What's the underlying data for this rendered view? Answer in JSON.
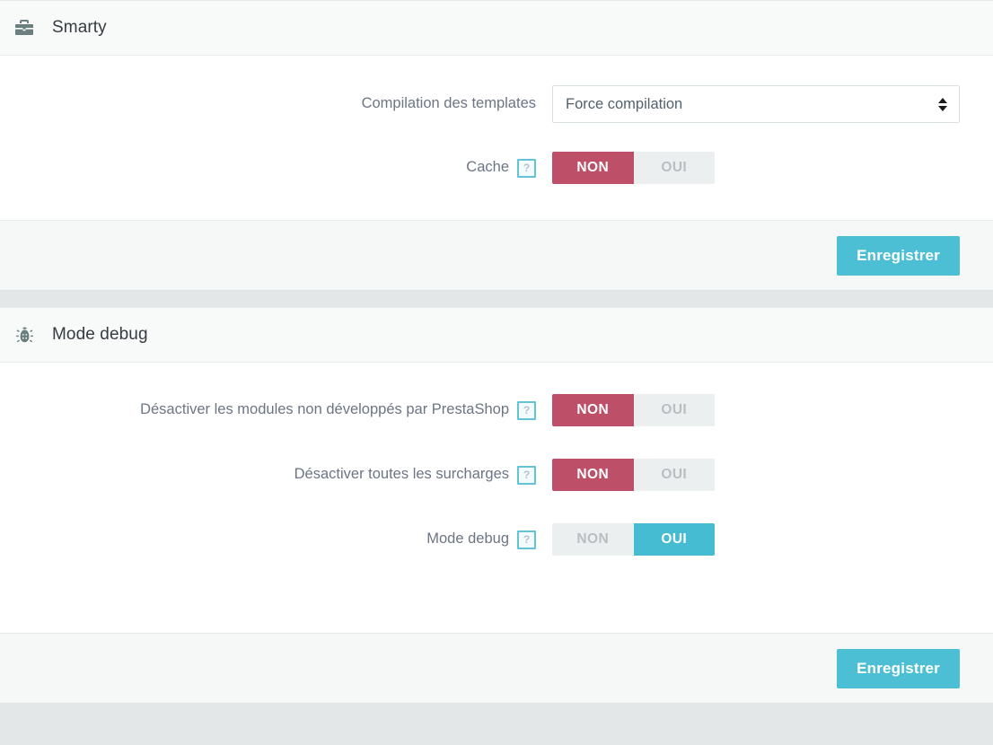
{
  "panels": [
    {
      "id": "smarty",
      "icon": "briefcase-icon",
      "title": "Smarty",
      "rows": [
        {
          "label": "Compilation des templates",
          "help": "",
          "type": "select",
          "value": "Force compilation"
        },
        {
          "label": "Cache",
          "help": "?",
          "type": "toggle",
          "no_label": "NON",
          "yes_label": "OUI",
          "state": "no"
        }
      ],
      "save_label": "Enregistrer"
    },
    {
      "id": "debug",
      "icon": "bug-icon",
      "title": "Mode debug",
      "rows": [
        {
          "label": "Désactiver les modules non développés par PrestaShop",
          "help": "?",
          "type": "toggle",
          "no_label": "NON",
          "yes_label": "OUI",
          "state": "no"
        },
        {
          "label": "Désactiver toutes les surcharges",
          "help": "?",
          "type": "toggle",
          "no_label": "NON",
          "yes_label": "OUI",
          "state": "no"
        },
        {
          "label": "Mode debug",
          "help": "?",
          "type": "toggle",
          "no_label": "NON",
          "yes_label": "OUI",
          "state": "yes"
        }
      ],
      "save_label": "Enregistrer"
    }
  ],
  "colors": {
    "accent_turquoise": "#4cbfd4",
    "toggle_on_no": "#bd4f68",
    "toggle_on_yes": "#45bcd2",
    "toggle_off_bg": "#eceff0",
    "panel_header_bg": "#f7faf9",
    "panel_footer_bg": "#f6f8f8",
    "help_border": "#63c4d6",
    "icon_gray": "#6b7f7f",
    "label_text": "#6c7584",
    "title_text": "#363a41"
  }
}
